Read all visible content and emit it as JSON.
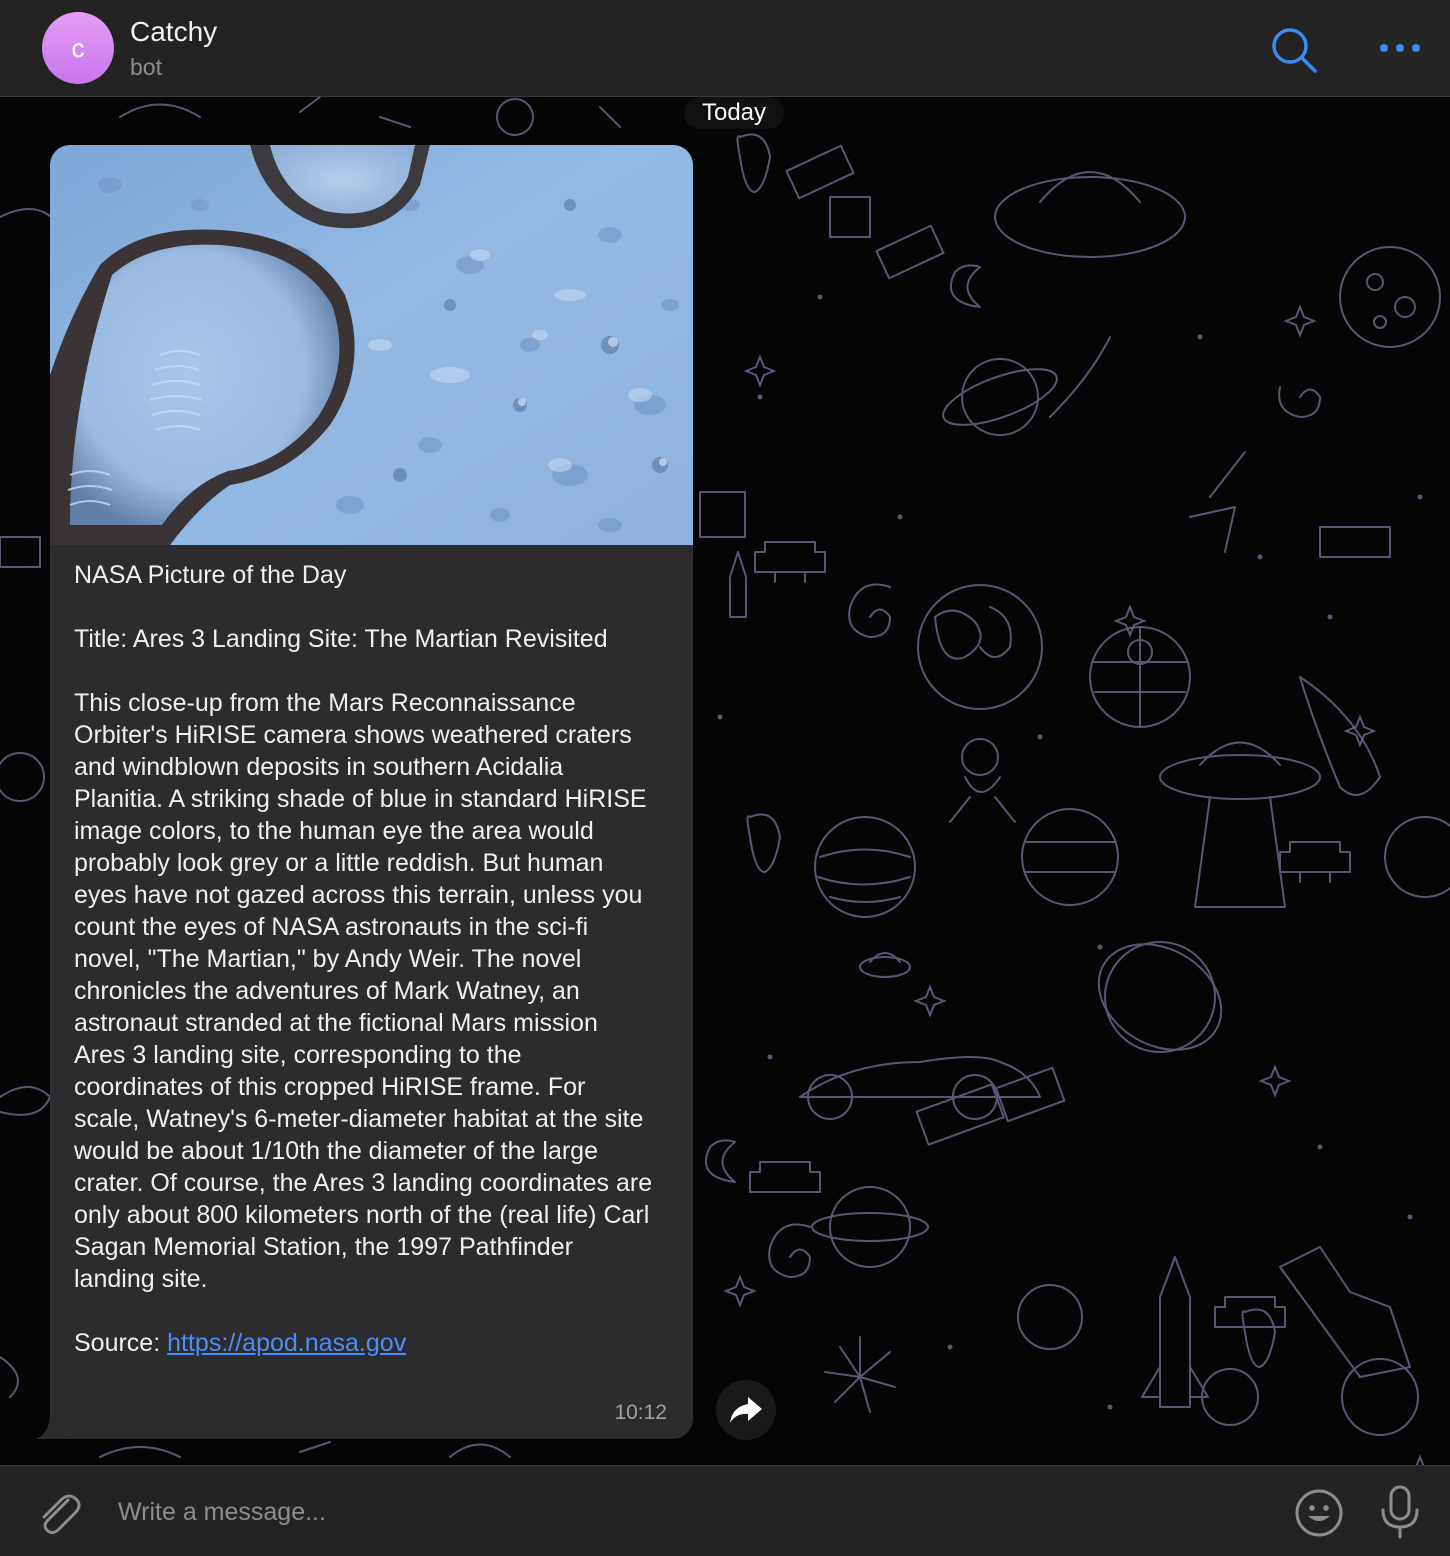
{
  "header": {
    "avatar_letter": "c",
    "chat_name": "Catchy",
    "chat_status": "bot"
  },
  "chat": {
    "date_label": "Today",
    "message": {
      "heading": "NASA Picture of the Day",
      "title": "Title: Ares 3 Landing Site: The Martian Revisited",
      "body": "This close-up from the Mars Reconnaissance Orbiter's HiRISE camera shows weathered craters and windblown deposits in southern Acidalia Planitia. A striking shade of blue in standard HiRISE image colors, to the human eye the area would probably look grey or a little reddish. But human eyes have not gazed across this terrain, unless you count the eyes of NASA astronauts in the sci-fi novel, \"The Martian,\" by Andy Weir. The novel chronicles the adventures of Mark Watney, an astronaut stranded at the fictional Mars mission Ares 3 landing site, corresponding to the coordinates of this cropped HiRISE frame. For scale, Watney's 6-meter-diameter habitat at the site would be about 1/10th the diameter of the large crater. Of course, the Ares 3 landing coordinates are only about 800 kilometers north of the (real life) Carl Sagan Memorial Station, the 1997 Pathfinder landing site.",
      "source_label": "Source:",
      "source_link": "https://apod.nasa.gov",
      "time": "10:12"
    }
  },
  "composer": {
    "placeholder": "Write a message..."
  },
  "icons": {
    "search": "search-icon",
    "more": "more-icon",
    "forward": "forward-icon",
    "attach": "paperclip-icon",
    "emoji": "emoji-icon",
    "mic": "microphone-icon"
  },
  "colors": {
    "accent": "#3d8bf0",
    "link": "#4c8ef7",
    "bubble": "#2c2c2e",
    "header": "#232323",
    "avatar_from": "#e69df5",
    "avatar_to": "#c876ee"
  }
}
